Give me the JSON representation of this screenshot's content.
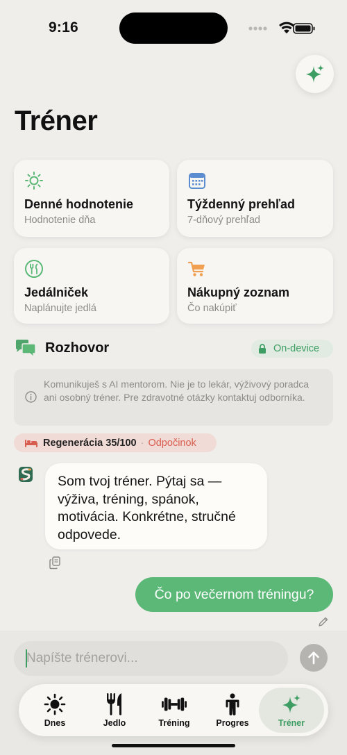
{
  "status": {
    "time": "9:16"
  },
  "page": {
    "title": "Tréner"
  },
  "tiles": [
    {
      "title": "Denné hodnotenie",
      "subtitle": "Hodnotenie dňa",
      "icon": "sun-icon",
      "color": "#5bb877"
    },
    {
      "title": "Týždenný prehľad",
      "subtitle": "7-dňový prehľad",
      "icon": "calendar-icon",
      "color": "#5b8ccf"
    },
    {
      "title": "Jedálniček",
      "subtitle": "Naplánujte jedlá",
      "icon": "fork-knife-icon",
      "color": "#5bb877"
    },
    {
      "title": "Nákupný zoznam",
      "subtitle": "Čo nakúpiť",
      "icon": "cart-icon",
      "color": "#f0a050"
    }
  ],
  "chat": {
    "title": "Rozhovor",
    "badge": "On-device",
    "disclaimer": "Komunikuješ s AI mentorom. Nie je to lekár, výživový poradca ani osobný tréner. Pre zdravotné otázky kontaktuj odborníka.",
    "regen_label": "Regenerácia 35/100",
    "regen_separator": "·",
    "regen_status": "Odpočinok",
    "messages": [
      {
        "role": "assistant",
        "text": "Som tvoj tréner. Pýtaj sa — výživa, tréning, spánok, motivácia. Konkrétne, stručné odpovede."
      },
      {
        "role": "user",
        "text": "Čo po večernom tréningu?"
      }
    ],
    "input_placeholder": "Napíšte trénerovi..."
  },
  "tabs": [
    {
      "label": "Dnes",
      "icon": "sun-icon"
    },
    {
      "label": "Jedlo",
      "icon": "fork-knife-icon"
    },
    {
      "label": "Tréning",
      "icon": "dumbbell-icon"
    },
    {
      "label": "Progres",
      "icon": "person-icon"
    },
    {
      "label": "Tréner",
      "icon": "sparkles-icon",
      "active": true
    }
  ],
  "colors": {
    "accent": "#3d9d62",
    "bubble_user": "#5bb877",
    "regen_text": "#d95d4e"
  }
}
